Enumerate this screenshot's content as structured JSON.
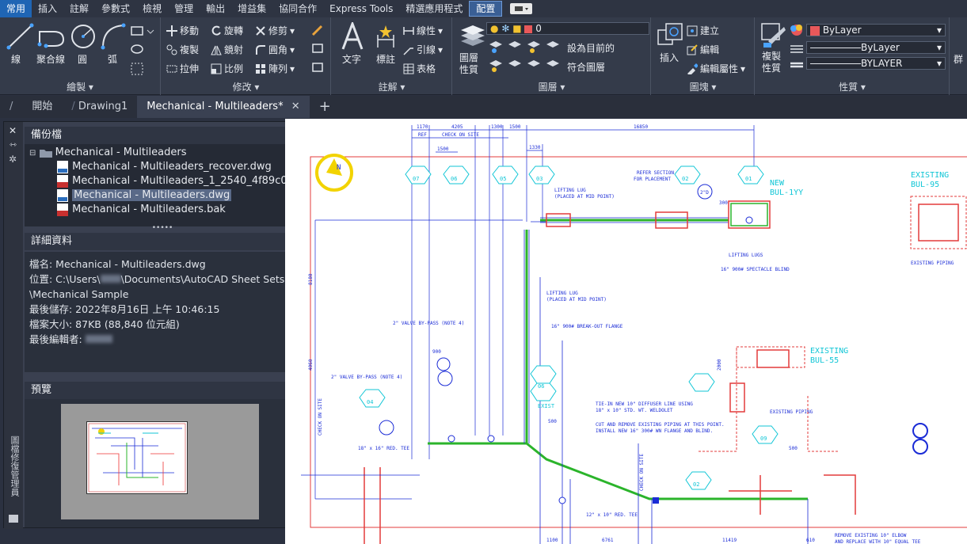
{
  "menubar": {
    "items": [
      "常用",
      "插入",
      "註解",
      "參數式",
      "檢視",
      "管理",
      "輸出",
      "增益集",
      "協同合作",
      "Express Tools",
      "精選應用程式",
      "配置"
    ]
  },
  "ribbon": {
    "draw": {
      "title": "繪製",
      "line": "線",
      "polyline": "聚合線",
      "circle": "圓",
      "arc": "弧"
    },
    "modify": {
      "title": "修改",
      "move": "移動",
      "rotate": "旋轉",
      "trim": "修剪",
      "copy": "複製",
      "mirror": "鏡射",
      "fillet": "圓角",
      "stretch": "拉伸",
      "scale": "比例",
      "array": "陣列"
    },
    "annotation": {
      "title": "註解",
      "text": "文字",
      "dimension": "標註",
      "linear": "線性",
      "leader": "引線",
      "table": "表格"
    },
    "layers": {
      "title": "圖層",
      "layer_props": "圖層\n性質",
      "current_layer": "0",
      "set_current": "設為目前的",
      "match_layer": "符合圖層"
    },
    "block": {
      "title": "圖塊",
      "insert": "插入",
      "create": "建立",
      "edit": "編輯",
      "edit_attr": "編輯屬性"
    },
    "properties": {
      "title": "性質",
      "match_props": "複製\n性質",
      "color": "ByLayer",
      "linetype": "ByLayer",
      "lineweight": "BYLAYER",
      "color_swatch": "#e8585a"
    },
    "groups_partial": "群"
  },
  "tabs": {
    "start": "開始",
    "drawing1": "Drawing1",
    "active": "Mechanical - Multileaders*"
  },
  "palette": {
    "side_title": "圖檔修復管理員",
    "backup_section": "備份檔",
    "tree": {
      "root": "Mechanical - Multileaders",
      "files": [
        {
          "name": "Mechanical - Multileaders_recover.dwg",
          "icon": "dwg"
        },
        {
          "name": "Mechanical - Multileaders_1_2540_4f89c079.sv$",
          "icon": "svs"
        },
        {
          "name": "Mechanical - Multileaders.dwg",
          "icon": "dwg",
          "selected": true
        },
        {
          "name": "Mechanical - Multileaders.bak",
          "icon": "bak"
        }
      ]
    },
    "details_section": "詳細資料",
    "details": {
      "filename": "檔名: Mechanical - Multileaders.dwg",
      "location_1": "位置: C:\\Users\\",
      "location_2": "\\Documents\\AutoCAD Sheet Sets",
      "location_3": "\\Mechanical Sample",
      "last_saved": "最後儲存: 2022年8月16日  上午 10:46:15",
      "file_size": "檔案大小: 87KB (88,840 位元組)",
      "last_editor": "最後編輯者:"
    },
    "preview_section": "預覽"
  },
  "drawing": {
    "dims_top": [
      "1170",
      "4205",
      "1300",
      "1500",
      "16850",
      "1500",
      "1330",
      "300"
    ],
    "ref": "REF",
    "check_on_site": "CHECK ON SITE",
    "tags": [
      "07",
      "06",
      "05",
      "03",
      "02",
      "01"
    ],
    "new_label": "NEW\nBUL-1YY",
    "existing_bul95": "EXISTING\nBUL-95",
    "existing_bul55": "EXISTING\nBUL-55",
    "notes": {
      "refer_section": "REFER SECTION\nFOR PLACEMENT",
      "lifting_lug_mid": "LIFTING LUG\n(PLACED AT MID POINT)",
      "lifting_lugs": "LIFTING LUGS",
      "spectacle_blind": "16\" 900# SPECTACLE BLIND",
      "existing_piping": "EXISTING PIPING",
      "lifting_lug_mid2": "LIFTING LUG\n(PLACED AT MID POINT)",
      "breakout_flange": "16\" 900# BREAK-OUT FLANGE",
      "valve_bypass1": "2\" VALVE BY-PASS (NOTE 4)",
      "valve_bypass2": "2\" VALVE BY-PASS (NOTE 4)",
      "tie_in": "TIE-IN NEW 10\" DIFFUSER LINE USING\n18\" x 10\" STD. WT. WELDOLET",
      "cut_remove": "CUT AND REMOVE EXISTING PIPING AT THIS POINT.\nINSTALL NEW 16\" 300# WN FLANGE AND BLIND.",
      "red_tee1": "18\" x 16\" RED. TEE",
      "red_tee2": "12\" x 10\" RED. TEE",
      "remove_elbow": "REMOVE EXISTING 10\" ELBOW\nAND REPLACE WITH 10\" EQUAL TEE",
      "existing_piping2": "EXISTING PIPING"
    },
    "dims_bottom": [
      "1100",
      "6761",
      "11419",
      "610"
    ],
    "dims_misc": [
      "900",
      "900",
      "8180",
      "4060",
      "2000",
      "500",
      "500",
      "510",
      "4580"
    ]
  }
}
